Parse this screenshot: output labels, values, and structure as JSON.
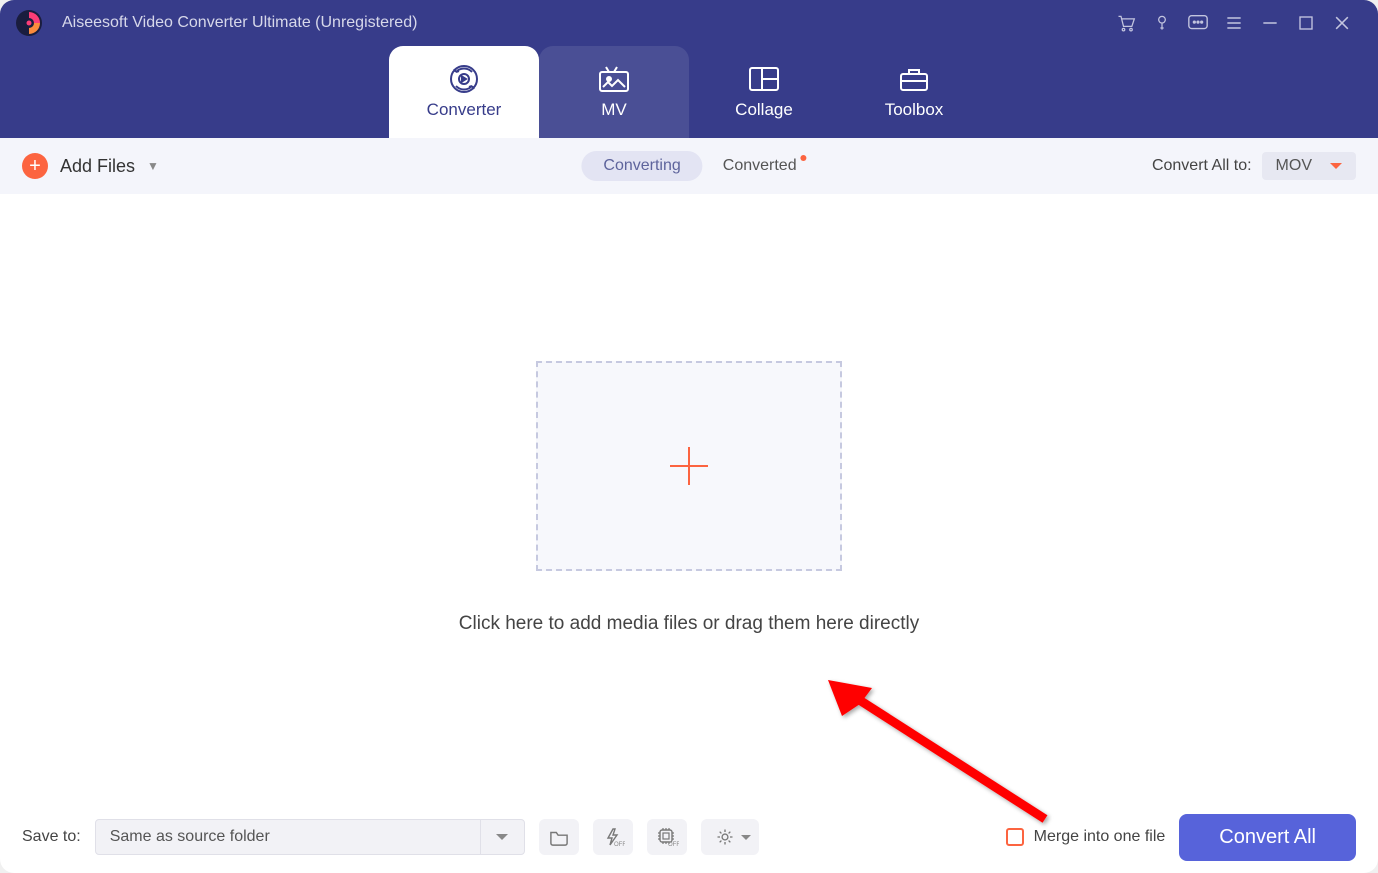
{
  "app": {
    "title": "Aiseesoft Video Converter Ultimate (Unregistered)"
  },
  "tabs": {
    "converter": "Converter",
    "mv": "MV",
    "collage": "Collage",
    "toolbox": "Toolbox"
  },
  "toolbar": {
    "add_files": "Add Files",
    "converting": "Converting",
    "converted": "Converted",
    "convert_all_to": "Convert All to:",
    "format_selected": "MOV"
  },
  "main": {
    "hint": "Click here to add media files or drag them here directly"
  },
  "bottom": {
    "save_to_label": "Save to:",
    "save_to_value": "Same as source folder",
    "merge_label": "Merge into one file",
    "convert_all": "Convert All"
  }
}
